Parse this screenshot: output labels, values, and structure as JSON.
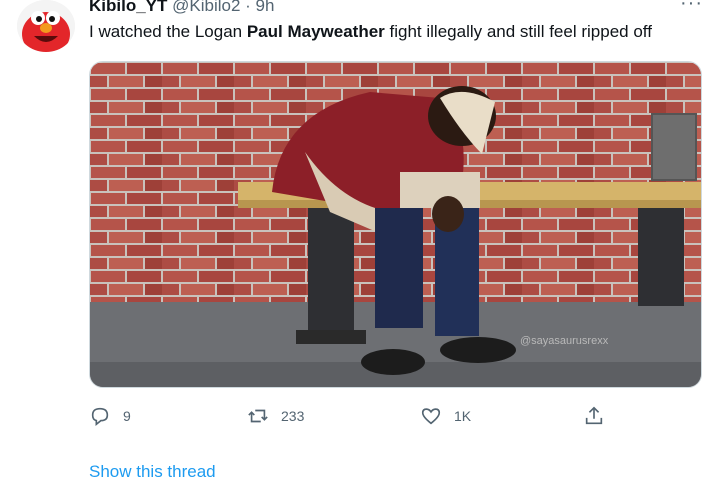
{
  "tweet": {
    "author_name": "Kibilo_YT",
    "handle": "@Kibilo2",
    "time": "· 9h",
    "more_label": "···",
    "text_before": "I watched the Logan ",
    "text_bold": "Paul Mayweather",
    "text_after": " fight illegally and still feel ripped off",
    "image_watermark": "@sayasaurusrexx",
    "actions": {
      "reply_count": "9",
      "retweet_count": "233",
      "like_count": "1K"
    },
    "show_thread_label": "Show this thread"
  },
  "colors": {
    "link": "#1d9bf0",
    "secondary_text": "#536471",
    "avatar_accent": "#e3262a"
  },
  "icons": {
    "more": "ellipsis-icon",
    "reply": "reply-icon",
    "retweet": "retweet-icon",
    "like": "heart-icon",
    "share": "share-icon"
  }
}
